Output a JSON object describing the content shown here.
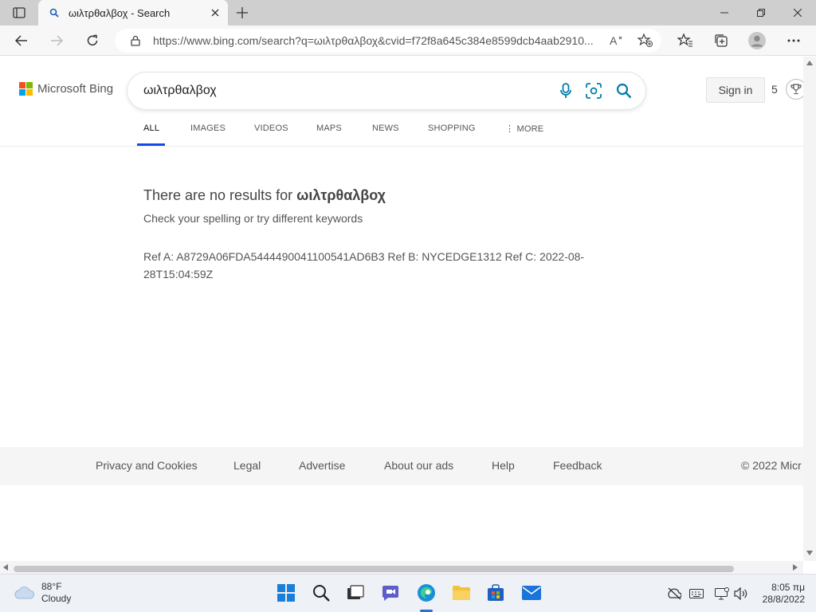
{
  "browser": {
    "tab": {
      "title": "ωιλτρθαλβοχ - Search",
      "favicon": "search-icon"
    },
    "address": {
      "url": "https://www.bing.com/search?q=ωιλτρθαλβοχ&cvid=f72f8a645c384e8599dcb4aab2910..."
    }
  },
  "bing": {
    "brand": "Microsoft Bing",
    "query": "ωιλτρθαλβοχ",
    "sign_in": "Sign in",
    "rewards_points": "5",
    "tabs": [
      {
        "label": "ALL"
      },
      {
        "label": "IMAGES"
      },
      {
        "label": "VIDEOS"
      },
      {
        "label": "MAPS"
      },
      {
        "label": "NEWS"
      },
      {
        "label": "SHOPPING"
      },
      {
        "label": "MORE"
      }
    ],
    "active_tab": "ALL",
    "no_results_prefix": "There are no results for",
    "no_results_query": "ωιλτρθαλβοχ",
    "hint": "Check your spelling or try different keywords",
    "ref": "Ref A: A8729A06FDA5444490041100541AD6B3 Ref B: NYCEDGE1312 Ref C: 2022-08-28T15:04:59Z",
    "footer": {
      "links": [
        "Privacy and Cookies",
        "Legal",
        "Advertise",
        "About our ads",
        "Help",
        "Feedback"
      ],
      "copyright": "© 2022 Micr"
    },
    "colors": {
      "accent": "#174ae4",
      "icon_teal": "#007daa"
    }
  },
  "taskbar": {
    "weather": {
      "temp": "88°F",
      "condition": "Cloudy"
    },
    "time": "8:05 πμ",
    "date": "28/8/2022"
  }
}
